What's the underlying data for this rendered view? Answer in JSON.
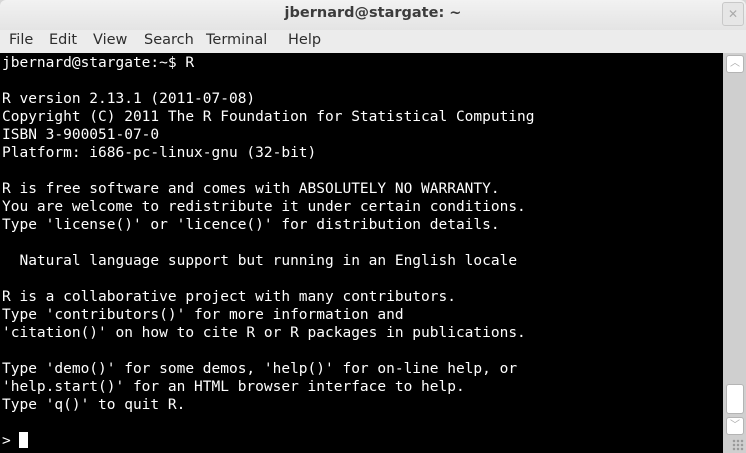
{
  "window": {
    "title": "jbernard@stargate: ~"
  },
  "menu": [
    "File",
    "Edit",
    "View",
    "Search",
    "Terminal",
    "Help"
  ],
  "terminal": {
    "lines": [
      "jbernard@stargate:~$ R",
      "",
      "R version 2.13.1 (2011-07-08)",
      "Copyright (C) 2011 The R Foundation for Statistical Computing",
      "ISBN 3-900051-07-0",
      "Platform: i686-pc-linux-gnu (32-bit)",
      "",
      "R is free software and comes with ABSOLUTELY NO WARRANTY.",
      "You are welcome to redistribute it under certain conditions.",
      "Type 'license()' or 'licence()' for distribution details.",
      "",
      "  Natural language support but running in an English locale",
      "",
      "R is a collaborative project with many contributors.",
      "Type 'contributors()' for more information and",
      "'citation()' on how to cite R or R packages in publications.",
      "",
      "Type 'demo()' for some demos, 'help()' for on-line help, or",
      "'help.start()' for an HTML browser interface to help.",
      "Type 'q()' to quit R.",
      ""
    ],
    "prompt": "> "
  }
}
